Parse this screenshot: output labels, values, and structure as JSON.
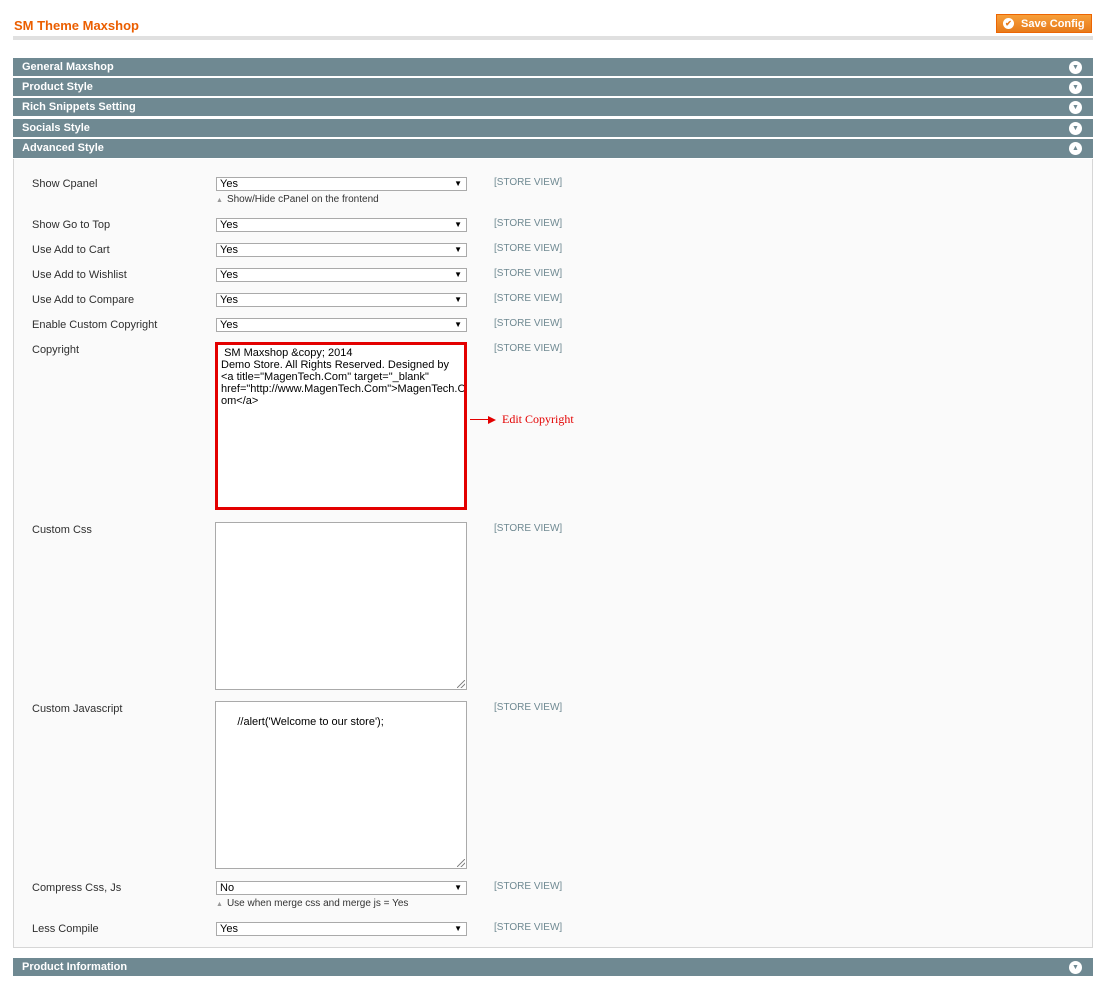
{
  "header": {
    "title": "SM Theme Maxshop",
    "save_label": "Save Config"
  },
  "sections": {
    "general": "General Maxshop",
    "product_style": "Product Style",
    "rich_snippets": "Rich Snippets Setting",
    "socials": "Socials Style",
    "advanced": "Advanced Style",
    "product_info": "Product Information"
  },
  "scope_label": "[STORE VIEW]",
  "fields": {
    "show_cpanel": {
      "label": "Show Cpanel",
      "value": "Yes",
      "note": "Show/Hide cPanel on the frontend"
    },
    "show_go_top": {
      "label": "Show Go to Top",
      "value": "Yes"
    },
    "use_add_cart": {
      "label": "Use Add to Cart",
      "value": "Yes"
    },
    "use_add_wishlist": {
      "label": "Use Add to Wishlist",
      "value": "Yes"
    },
    "use_add_compare": {
      "label": "Use Add to Compare",
      "value": "Yes"
    },
    "enable_copyright": {
      "label": "Enable Custom Copyright",
      "value": "Yes"
    },
    "copyright": {
      "label": "Copyright",
      "value": " SM Maxshop &copy; 2014\nDemo Store. All Rights Reserved. Designed by\n<a title=\"MagenTech.Com\" target=\"_blank\"\nhref=\"http://www.MagenTech.Com\">MagenTech.C\nom</a>"
    },
    "custom_css": {
      "label": "Custom Css",
      "value": ""
    },
    "custom_js": {
      "label": "Custom Javascript",
      "value": "//alert('Welcome to our store');"
    },
    "compress": {
      "label": "Compress Css, Js",
      "value": "No",
      "note": "Use when merge css and merge js = Yes"
    },
    "less_compile": {
      "label": "Less Compile",
      "value": "Yes"
    }
  },
  "annotation": {
    "text": "Edit Copyright",
    "color": "#e30000"
  },
  "colors": {
    "accent": "#eb5e00",
    "section_bar": "#6f8992",
    "button": "#f18200"
  }
}
